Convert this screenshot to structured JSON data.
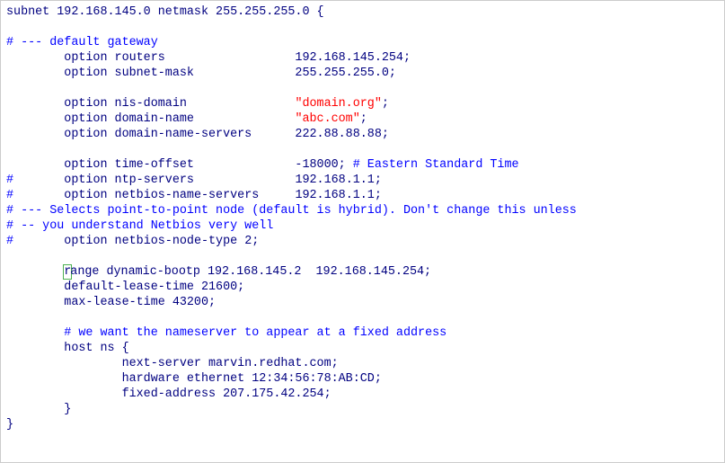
{
  "c0": "subnet 192.168.145.0 netmask 255.255.255.0 {",
  "c1": "# --- default gateway",
  "c2": "        option routers                  192.168.145.254;",
  "c3": "        option subnet-mask              255.255.255.0;",
  "c4": "        option nis-domain               ",
  "c4s": "\"domain.org\"",
  "c4e": ";",
  "c5": "        option domain-name              ",
  "c5s": "\"abc.com\"",
  "c5e": ";",
  "c6": "        option domain-name-servers      222.88.88.88;",
  "c7": "        option time-offset              -18000; ",
  "c7c": "# Eastern Standard Time",
  "c8h": "#",
  "c8": "       option ntp-servers              192.168.1.1;",
  "c9h": "#",
  "c9": "       option netbios-name-servers     192.168.1.1;",
  "c10": "# --- Selects point-to-point node (default is hybrid). Don't change this unless",
  "c11": "# -- you understand Netbios very well",
  "c12h": "#",
  "c12": "       option netbios-node-type 2;",
  "c13a": "        ",
  "c13c": "r",
  "c13b": "ange dynamic-bootp 192.168.145.2  192.168.145.254;",
  "c14": "        default-lease-time 21600;",
  "c15": "        max-lease-time 43200;",
  "c16": "        # we want the nameserver to appear at a fixed address",
  "c17": "        host ns {",
  "c18": "                next-server marvin.redhat.com;",
  "c19": "                hardware ethernet 12:34:56:78:AB:CD;",
  "c20": "                fixed-address 207.175.42.254;",
  "c21": "        }",
  "c22": "}",
  "chart_data": null
}
